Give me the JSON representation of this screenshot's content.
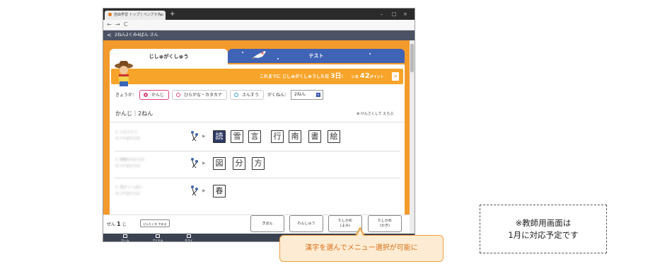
{
  "browser": {
    "tab_title": "自由学習 トップ | ペンブラネット",
    "close_glyph": "×",
    "new_tab_glyph": "+",
    "window_controls": [
      "–",
      "□",
      "×"
    ],
    "nav_icons": [
      "←",
      "→",
      "C"
    ]
  },
  "app_header": {
    "back_glyph": "<",
    "title": "2ねん2くみ4ばん さん"
  },
  "tabs": [
    {
      "label": "じしゅがくしゅう",
      "active": true
    },
    {
      "label": "テスト",
      "active": false
    }
  ],
  "banner": {
    "msg_prefix": "これまでに じしゅがくしゅうした日 ",
    "days": "3日",
    "msg_suffix": "！",
    "points_prefix": "いま ",
    "points": "42",
    "points_unit": "ポイント",
    "arrow": ">"
  },
  "filters": {
    "subject_label": "きょうか：",
    "subjects": [
      {
        "label": "かんじ",
        "selected": true,
        "color": "#e0457b"
      },
      {
        "label": "ひらがな・カタカナ",
        "selected": false,
        "color": "#e0457b"
      },
      {
        "label": "さんすう",
        "selected": false,
        "color": "#3aa0d8"
      }
    ],
    "grade_label": "がくねん：",
    "grade_value": "2ねん",
    "grade_caret": "▾"
  },
  "section": {
    "title": "かんじ｜2ねん",
    "find_label": "けんさくして えらぶ",
    "find_icon": "⊕"
  },
  "rows": [
    {
      "label1": "1. ふるさとう",
      "label2": "なつやまからの",
      "kanji": [
        "読",
        "雪",
        "言",
        "行",
        "南",
        "書",
        "絵"
      ],
      "selected_index": 0
    },
    {
      "label1": "2. 細胞のちからの",
      "label2": "なつやまからの",
      "kanji": [
        "図",
        "分",
        "方"
      ],
      "selected_index": -1
    },
    {
      "label1": "3. 音が いっぱい",
      "label2": "なつやまからの",
      "kanji": [
        "春"
      ],
      "selected_index": -1
    }
  ],
  "footer": {
    "zen": "ぜん",
    "count": "1",
    "count_unit": "じ",
    "stop_label": "せんたくを やめる",
    "buttons": [
      {
        "line1": "きほん",
        "line2": ""
      },
      {
        "line1": "れんしゅう",
        "line2": ""
      },
      {
        "line1": "たしかめ",
        "line2": "(よみ)"
      },
      {
        "line1": "たしかめ",
        "line2": "(かき)"
      }
    ]
  },
  "bottom_nav": [
    {
      "label": "ホーム"
    },
    {
      "label": "アイテム"
    },
    {
      "label": "きろく"
    }
  ],
  "callout": "漢字を選んでメニュー選択が可能に",
  "note": {
    "line1": "※教師用画面は",
    "line2": "1月に対応予定です"
  },
  "colors": {
    "accent_orange": "#f39a2c",
    "tab_blue": "#3f63b5",
    "header_dark": "#4a5263",
    "selected_kanji": "#2d3a63"
  }
}
